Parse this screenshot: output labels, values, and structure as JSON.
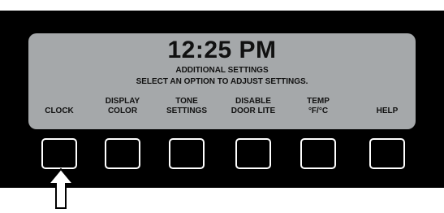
{
  "display": {
    "time": "12:25 PM",
    "line1": "ADDITIONAL SETTINGS",
    "line2": "SELECT AN OPTION TO ADJUST SETTINGS."
  },
  "options": [
    {
      "line1": "",
      "line2": "CLOCK"
    },
    {
      "line1": "DISPLAY",
      "line2": "COLOR"
    },
    {
      "line1": "TONE",
      "line2": "SETTINGS"
    },
    {
      "line1": "DISABLE",
      "line2": "DOOR LITE"
    },
    {
      "line1": "TEMP",
      "line2": "°F/°C"
    },
    {
      "line1": "",
      "line2": "HELP"
    }
  ],
  "indicator": {
    "icon": "up-arrow-icon",
    "points_to_option": 0
  },
  "colors": {
    "panel": "#000000",
    "screen": "#a5a8aa",
    "button_outline": "#ffffff"
  }
}
